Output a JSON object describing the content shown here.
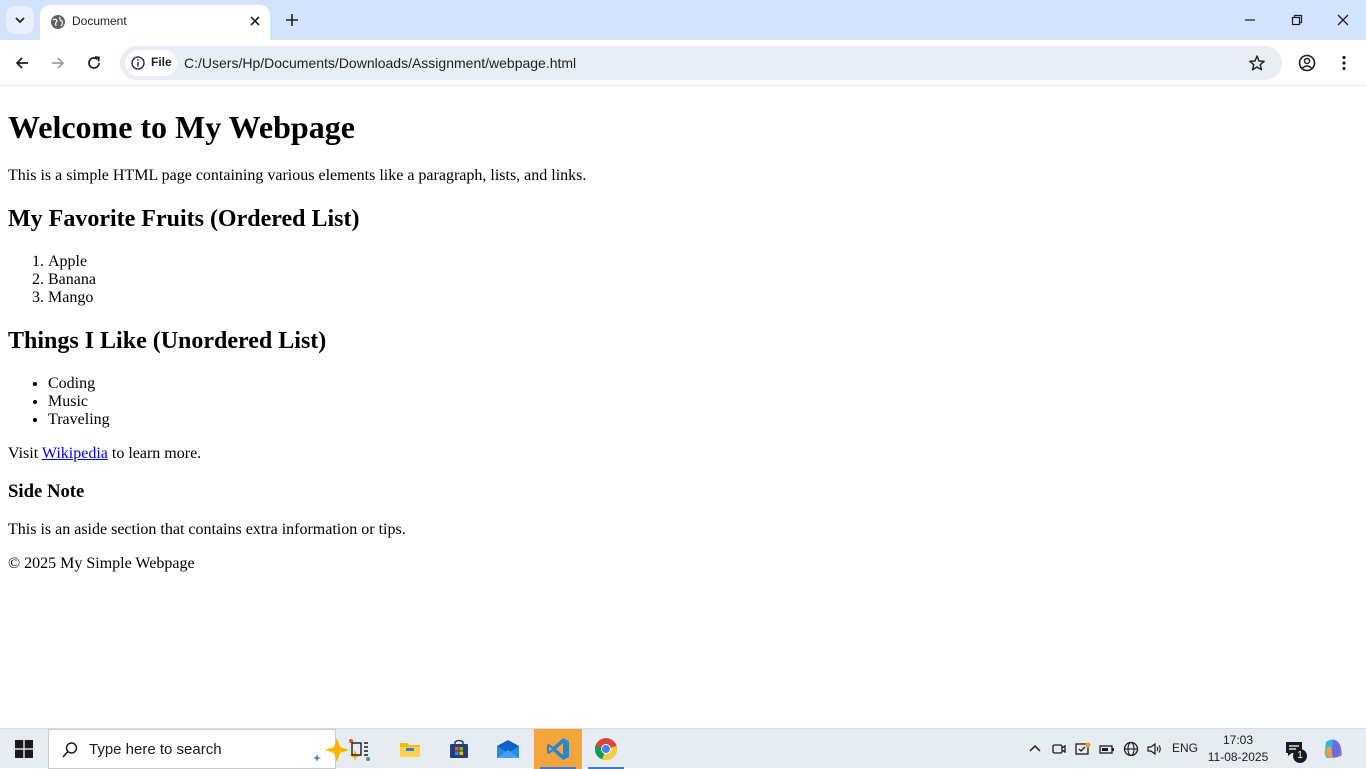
{
  "browser": {
    "tab_title": "Document",
    "site_chip_label": "File",
    "url": "C:/Users/Hp/Documents/Downloads/Assignment/webpage.html"
  },
  "page": {
    "heading": "Welcome to My Webpage",
    "intro": "This is a simple HTML page containing various elements like a paragraph, lists, and links.",
    "fruits_heading": "My Favorite Fruits (Ordered List)",
    "fruits": [
      "Apple",
      "Banana",
      "Mango"
    ],
    "likes_heading": "Things I Like (Unordered List)",
    "likes": [
      "Coding",
      "Music",
      "Traveling"
    ],
    "visit_prefix": "Visit ",
    "visit_link": "Wikipedia",
    "visit_suffix": " to learn more.",
    "aside_heading": "Side Note",
    "aside_text": "This is an aside section that contains extra information or tips.",
    "footer": "© 2025 My Simple Webpage"
  },
  "taskbar": {
    "search_placeholder": "Type here to search",
    "language": "ENG",
    "time": "17:03",
    "date": "11-08-2025",
    "notification_count": "1"
  },
  "icons": {
    "tab_favicon": "globe-icon",
    "vscode": "vscode-icon",
    "chrome": "chrome-icon"
  },
  "colors": {
    "tabstrip": "#d3e3fd",
    "omnibox": "#e9eef6",
    "link": "#0000ee",
    "taskbar": "#e7ecf3",
    "active_app": "#f6a53c"
  }
}
